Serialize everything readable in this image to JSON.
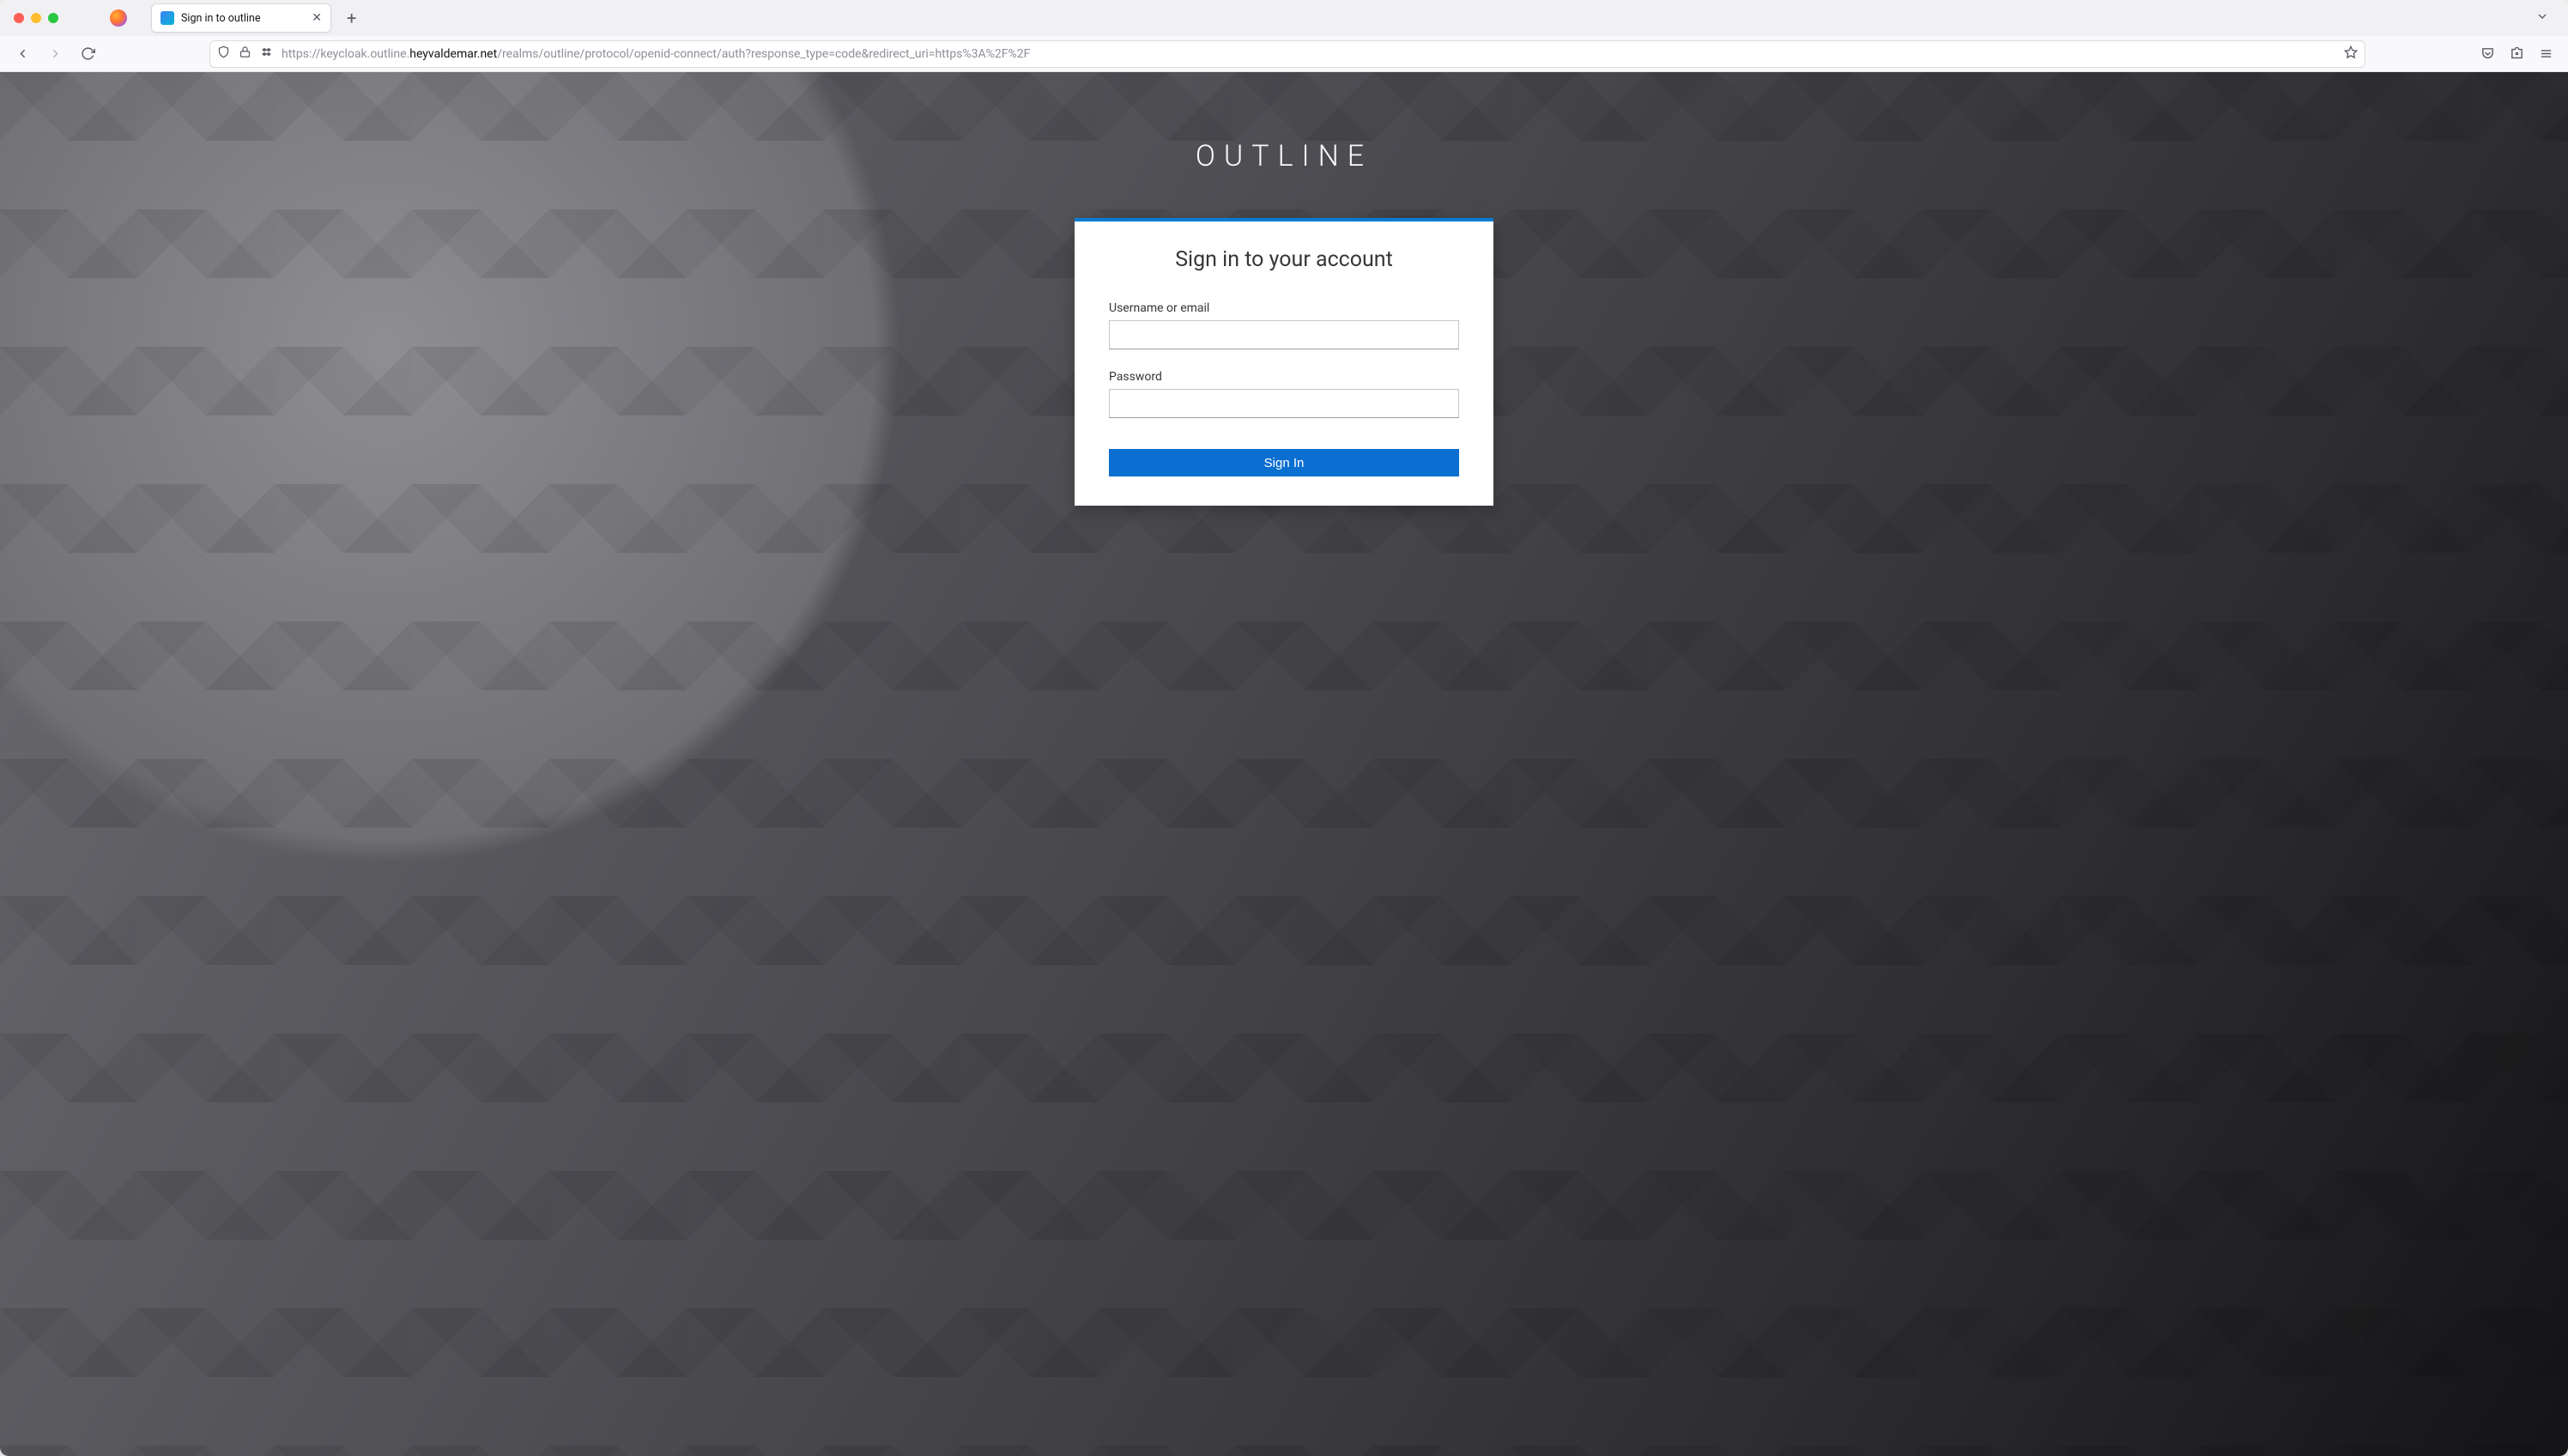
{
  "browser_tab": {
    "title": "Sign in to outline"
  },
  "url": {
    "prefix": "https://keycloak.outline.",
    "host": "heyvaldemar.net",
    "path": "/realms/outline/protocol/openid-connect/auth?response_type=code&redirect_uri=https%3A%2F%2F"
  },
  "page": {
    "realm_title": "OUTLINE",
    "card_heading": "Sign in to your account",
    "username_label": "Username or email",
    "username_value": "",
    "password_label": "Password",
    "password_value": "",
    "submit_label": "Sign In"
  }
}
